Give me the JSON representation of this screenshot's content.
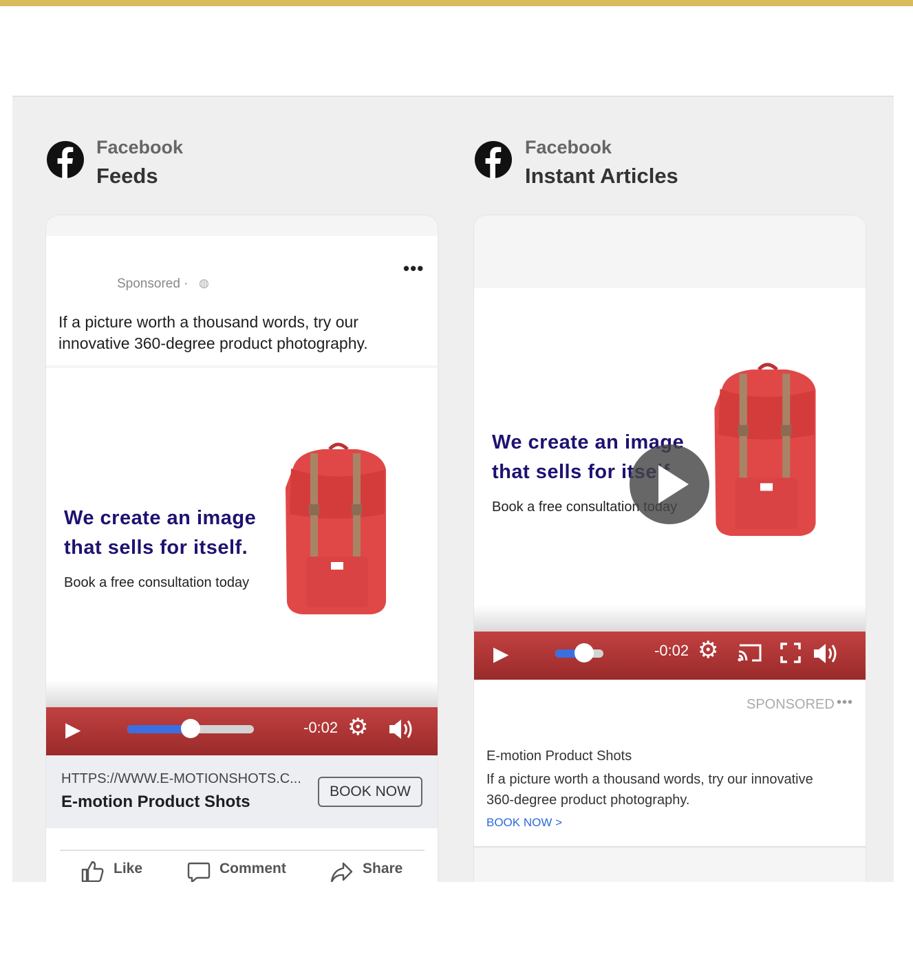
{
  "colors": {
    "accent_bar": "#d9bb5c",
    "headline": "#1d1270",
    "control_bar": "#b03535",
    "progress": "#3b6fe0",
    "link": "#2d6ad9"
  },
  "feeds": {
    "platform": "Facebook",
    "placement": "Feeds",
    "sponsored": "Sponsored ·",
    "caption_line1": "If a picture worth a thousand words, try our",
    "caption_line2": "innovative 360-degree product photography.",
    "headline_line1": "We create an image",
    "headline_line2": "that sells for itself.",
    "subline": "Book a free consultation today",
    "time": "-0:02",
    "progress_fraction": 0.5,
    "link_url": "HTTPS://WWW.E-MOTIONSHOTS.C...",
    "link_title": "E-motion Product Shots",
    "cta": "BOOK NOW",
    "actions": {
      "like": "Like",
      "comment": "Comment",
      "share": "Share"
    }
  },
  "instant": {
    "platform": "Facebook",
    "placement": "Instant Articles",
    "headline_line1": "We create an image",
    "headline_line2": "that sells for itself.",
    "subline": "Book a free consultation today",
    "time": "-0:02",
    "progress_fraction": 0.6,
    "sponsored": "SPONSORED",
    "advertiser": "E-motion Product Shots",
    "desc_line1": "If a picture worth a thousand words, try our innovative",
    "desc_line2": "360-degree product photography.",
    "cta_link": "BOOK NOW >"
  }
}
